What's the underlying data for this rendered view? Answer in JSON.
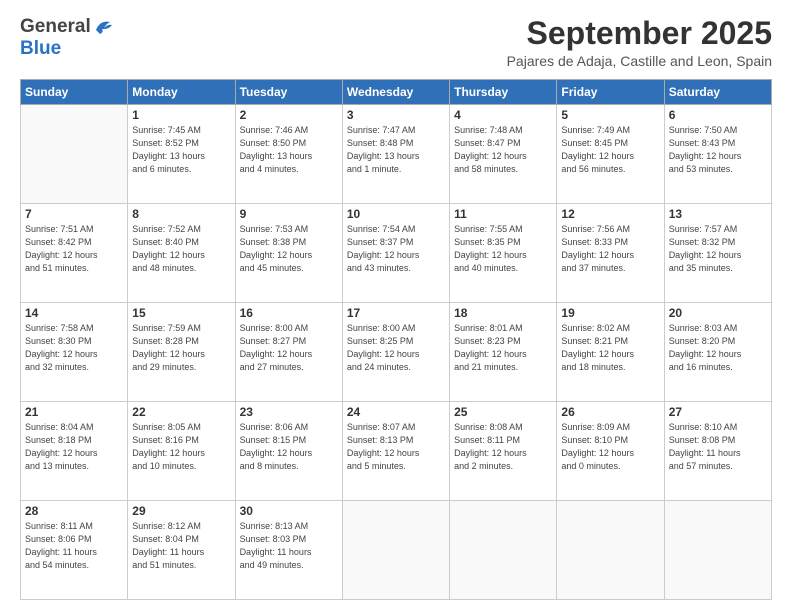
{
  "header": {
    "logo_general": "General",
    "logo_blue": "Blue",
    "title": "September 2025",
    "location": "Pajares de Adaja, Castille and Leon, Spain"
  },
  "days_of_week": [
    "Sunday",
    "Monday",
    "Tuesday",
    "Wednesday",
    "Thursday",
    "Friday",
    "Saturday"
  ],
  "weeks": [
    [
      {
        "day": "",
        "info": ""
      },
      {
        "day": "1",
        "info": "Sunrise: 7:45 AM\nSunset: 8:52 PM\nDaylight: 13 hours\nand 6 minutes."
      },
      {
        "day": "2",
        "info": "Sunrise: 7:46 AM\nSunset: 8:50 PM\nDaylight: 13 hours\nand 4 minutes."
      },
      {
        "day": "3",
        "info": "Sunrise: 7:47 AM\nSunset: 8:48 PM\nDaylight: 13 hours\nand 1 minute."
      },
      {
        "day": "4",
        "info": "Sunrise: 7:48 AM\nSunset: 8:47 PM\nDaylight: 12 hours\nand 58 minutes."
      },
      {
        "day": "5",
        "info": "Sunrise: 7:49 AM\nSunset: 8:45 PM\nDaylight: 12 hours\nand 56 minutes."
      },
      {
        "day": "6",
        "info": "Sunrise: 7:50 AM\nSunset: 8:43 PM\nDaylight: 12 hours\nand 53 minutes."
      }
    ],
    [
      {
        "day": "7",
        "info": "Sunrise: 7:51 AM\nSunset: 8:42 PM\nDaylight: 12 hours\nand 51 minutes."
      },
      {
        "day": "8",
        "info": "Sunrise: 7:52 AM\nSunset: 8:40 PM\nDaylight: 12 hours\nand 48 minutes."
      },
      {
        "day": "9",
        "info": "Sunrise: 7:53 AM\nSunset: 8:38 PM\nDaylight: 12 hours\nand 45 minutes."
      },
      {
        "day": "10",
        "info": "Sunrise: 7:54 AM\nSunset: 8:37 PM\nDaylight: 12 hours\nand 43 minutes."
      },
      {
        "day": "11",
        "info": "Sunrise: 7:55 AM\nSunset: 8:35 PM\nDaylight: 12 hours\nand 40 minutes."
      },
      {
        "day": "12",
        "info": "Sunrise: 7:56 AM\nSunset: 8:33 PM\nDaylight: 12 hours\nand 37 minutes."
      },
      {
        "day": "13",
        "info": "Sunrise: 7:57 AM\nSunset: 8:32 PM\nDaylight: 12 hours\nand 35 minutes."
      }
    ],
    [
      {
        "day": "14",
        "info": "Sunrise: 7:58 AM\nSunset: 8:30 PM\nDaylight: 12 hours\nand 32 minutes."
      },
      {
        "day": "15",
        "info": "Sunrise: 7:59 AM\nSunset: 8:28 PM\nDaylight: 12 hours\nand 29 minutes."
      },
      {
        "day": "16",
        "info": "Sunrise: 8:00 AM\nSunset: 8:27 PM\nDaylight: 12 hours\nand 27 minutes."
      },
      {
        "day": "17",
        "info": "Sunrise: 8:00 AM\nSunset: 8:25 PM\nDaylight: 12 hours\nand 24 minutes."
      },
      {
        "day": "18",
        "info": "Sunrise: 8:01 AM\nSunset: 8:23 PM\nDaylight: 12 hours\nand 21 minutes."
      },
      {
        "day": "19",
        "info": "Sunrise: 8:02 AM\nSunset: 8:21 PM\nDaylight: 12 hours\nand 18 minutes."
      },
      {
        "day": "20",
        "info": "Sunrise: 8:03 AM\nSunset: 8:20 PM\nDaylight: 12 hours\nand 16 minutes."
      }
    ],
    [
      {
        "day": "21",
        "info": "Sunrise: 8:04 AM\nSunset: 8:18 PM\nDaylight: 12 hours\nand 13 minutes."
      },
      {
        "day": "22",
        "info": "Sunrise: 8:05 AM\nSunset: 8:16 PM\nDaylight: 12 hours\nand 10 minutes."
      },
      {
        "day": "23",
        "info": "Sunrise: 8:06 AM\nSunset: 8:15 PM\nDaylight: 12 hours\nand 8 minutes."
      },
      {
        "day": "24",
        "info": "Sunrise: 8:07 AM\nSunset: 8:13 PM\nDaylight: 12 hours\nand 5 minutes."
      },
      {
        "day": "25",
        "info": "Sunrise: 8:08 AM\nSunset: 8:11 PM\nDaylight: 12 hours\nand 2 minutes."
      },
      {
        "day": "26",
        "info": "Sunrise: 8:09 AM\nSunset: 8:10 PM\nDaylight: 12 hours\nand 0 minutes."
      },
      {
        "day": "27",
        "info": "Sunrise: 8:10 AM\nSunset: 8:08 PM\nDaylight: 11 hours\nand 57 minutes."
      }
    ],
    [
      {
        "day": "28",
        "info": "Sunrise: 8:11 AM\nSunset: 8:06 PM\nDaylight: 11 hours\nand 54 minutes."
      },
      {
        "day": "29",
        "info": "Sunrise: 8:12 AM\nSunset: 8:04 PM\nDaylight: 11 hours\nand 51 minutes."
      },
      {
        "day": "30",
        "info": "Sunrise: 8:13 AM\nSunset: 8:03 PM\nDaylight: 11 hours\nand 49 minutes."
      },
      {
        "day": "",
        "info": ""
      },
      {
        "day": "",
        "info": ""
      },
      {
        "day": "",
        "info": ""
      },
      {
        "day": "",
        "info": ""
      }
    ]
  ]
}
